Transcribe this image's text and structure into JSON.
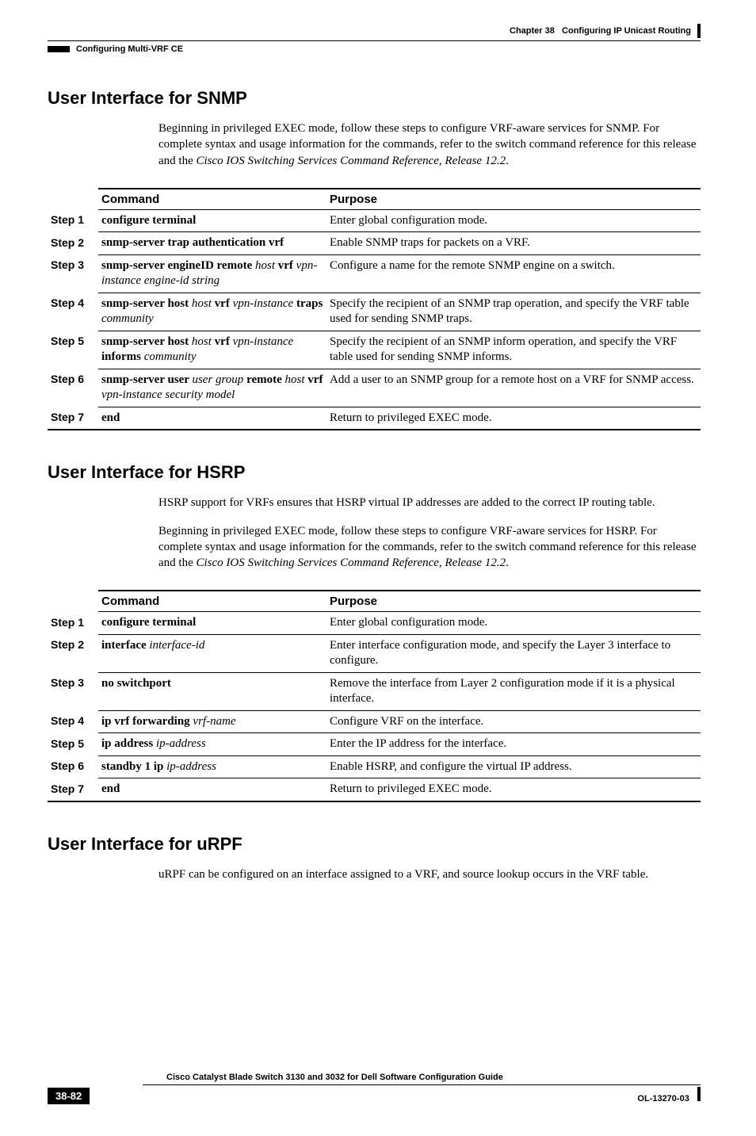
{
  "header": {
    "left": "Configuring Multi-VRF CE",
    "right_chapter": "Chapter 38",
    "right_title": "Configuring IP Unicast Routing"
  },
  "sections": {
    "snmp": {
      "heading": "User Interface for SNMP",
      "intro_parts": {
        "p1a": "Beginning in privileged EXEC mode, follow these steps to configure VRF-aware services for SNMP. For complete syntax and usage information for the commands, refer to the switch command reference for this release and the ",
        "p1b": "Cisco IOS Switching Services Command Reference, Release 12.2",
        "p1c": "."
      },
      "table": {
        "headers": {
          "command": "Command",
          "purpose": "Purpose"
        },
        "rows": [
          {
            "step": "Step 1",
            "command_segments": [
              {
                "t": "configure terminal",
                "style": "bold"
              }
            ],
            "purpose": "Enter global configuration mode."
          },
          {
            "step": "Step 2",
            "command_segments": [
              {
                "t": "snmp-server trap authentication vrf",
                "style": "bold"
              }
            ],
            "purpose": "Enable SNMP traps for packets on a VRF."
          },
          {
            "step": "Step 3",
            "command_segments": [
              {
                "t": "snmp-server engineID remote ",
                "style": "bold"
              },
              {
                "t": "host",
                "style": "italic"
              },
              {
                "t": " vrf ",
                "style": "bold"
              },
              {
                "t": "vpn-instance engine-id string",
                "style": "italic"
              }
            ],
            "purpose": "Configure a name for the remote SNMP engine on a switch."
          },
          {
            "step": "Step 4",
            "command_segments": [
              {
                "t": "snmp-server host ",
                "style": "bold"
              },
              {
                "t": "host",
                "style": "italic"
              },
              {
                "t": " vrf ",
                "style": "bold"
              },
              {
                "t": "vpn-instance",
                "style": "italic"
              },
              {
                "t": " traps ",
                "style": "bold"
              },
              {
                "t": "community",
                "style": "italic"
              }
            ],
            "purpose": "Specify the recipient of an SNMP trap operation, and specify the VRF table used for sending SNMP traps."
          },
          {
            "step": "Step 5",
            "command_segments": [
              {
                "t": "snmp-server host ",
                "style": "bold"
              },
              {
                "t": "host",
                "style": "italic"
              },
              {
                "t": " vrf ",
                "style": "bold"
              },
              {
                "t": "vpn-instance",
                "style": "italic"
              },
              {
                "t": " informs ",
                "style": "bold"
              },
              {
                "t": "community",
                "style": "italic"
              }
            ],
            "purpose": "Specify the recipient of an SNMP inform operation, and specify the VRF table used for sending SNMP informs."
          },
          {
            "step": "Step 6",
            "command_segments": [
              {
                "t": "snmp-server user ",
                "style": "bold"
              },
              {
                "t": "user group",
                "style": "italic"
              },
              {
                "t": " remote ",
                "style": "bold"
              },
              {
                "t": "host",
                "style": "italic"
              },
              {
                "t": " vrf ",
                "style": "bold"
              },
              {
                "t": "vpn-instance security model",
                "style": "italic"
              }
            ],
            "purpose": "Add a user to an SNMP group for a remote host on a VRF for SNMP access."
          },
          {
            "step": "Step 7",
            "command_segments": [
              {
                "t": "end",
                "style": "bold"
              }
            ],
            "purpose": "Return to privileged EXEC mode."
          }
        ]
      }
    },
    "hsrp": {
      "heading": "User Interface for HSRP",
      "intro1": "HSRP support for VRFs ensures that HSRP virtual IP addresses are added to the correct IP routing table.",
      "intro_parts": {
        "p1a": "Beginning in privileged EXEC mode, follow these steps to configure VRF-aware services for HSRP. For complete syntax and usage information for the commands, refer to the switch command reference for this release and the ",
        "p1b": "Cisco IOS Switching Services Command Reference, Release 12.2",
        "p1c": "."
      },
      "table": {
        "headers": {
          "command": "Command",
          "purpose": "Purpose"
        },
        "rows": [
          {
            "step": "Step 1",
            "command_segments": [
              {
                "t": "configure terminal",
                "style": "bold"
              }
            ],
            "purpose": "Enter global configuration mode."
          },
          {
            "step": "Step 2",
            "command_segments": [
              {
                "t": "interface ",
                "style": "bold"
              },
              {
                "t": "interface-id",
                "style": "italic"
              }
            ],
            "purpose": "Enter interface configuration mode, and specify the Layer 3 interface to configure."
          },
          {
            "step": "Step 3",
            "command_segments": [
              {
                "t": "no switchport",
                "style": "bold"
              }
            ],
            "purpose": "Remove the interface from Layer 2 configuration mode if it is a physical interface."
          },
          {
            "step": "Step 4",
            "command_segments": [
              {
                "t": "ip vrf forwarding ",
                "style": "bold"
              },
              {
                "t": "vrf-name",
                "style": "italic"
              }
            ],
            "purpose": "Configure VRF on the interface."
          },
          {
            "step": "Step 5",
            "command_segments": [
              {
                "t": "ip address ",
                "style": "bold"
              },
              {
                "t": "ip-address",
                "style": "italic"
              }
            ],
            "purpose": "Enter the IP address for the interface."
          },
          {
            "step": "Step 6",
            "command_segments": [
              {
                "t": "standby 1 ip ",
                "style": "bold"
              },
              {
                "t": "ip-address",
                "style": "italic"
              }
            ],
            "purpose": "Enable HSRP, and configure the virtual IP address."
          },
          {
            "step": "Step 7",
            "command_segments": [
              {
                "t": "end",
                "style": "bold"
              }
            ],
            "purpose": "Return to privileged EXEC mode."
          }
        ]
      }
    },
    "urpf": {
      "heading": "User Interface for uRPF",
      "intro": "uRPF can be configured on an interface assigned to a VRF, and source lookup occurs in the VRF table."
    }
  },
  "footer": {
    "title": "Cisco Catalyst Blade Switch 3130 and 3032 for Dell Software Configuration Guide",
    "page": "38-82",
    "docid": "OL-13270-03"
  }
}
